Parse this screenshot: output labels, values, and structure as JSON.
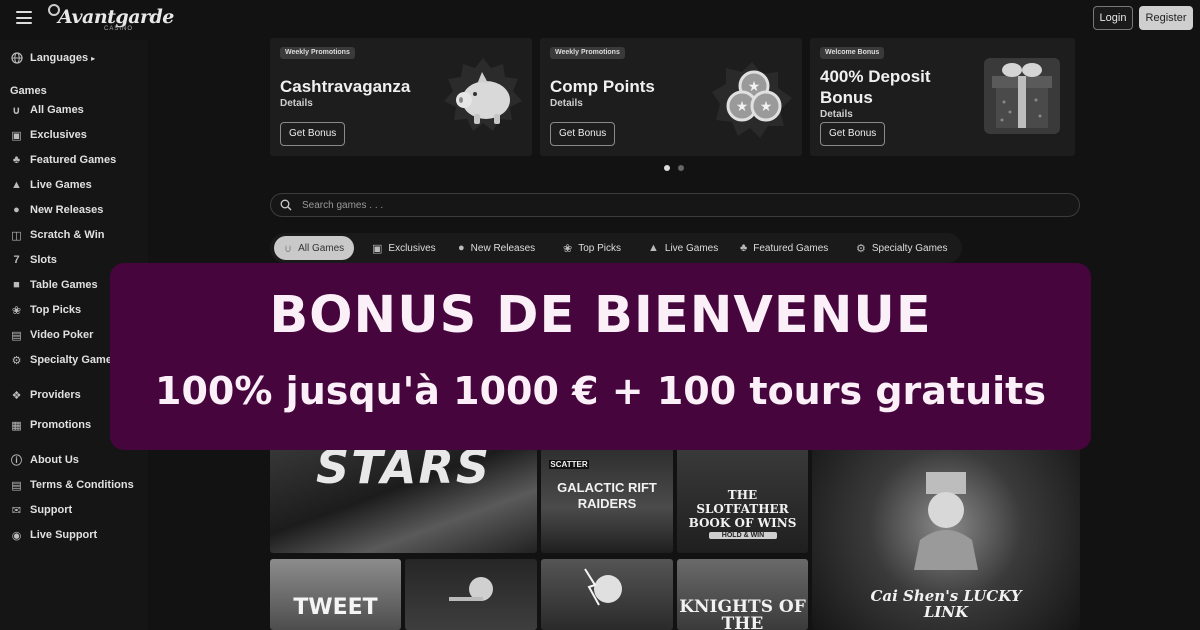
{
  "header": {
    "logo_text": "Avantgarde",
    "logo_sub": "CASINO",
    "login_label": "Login",
    "register_label": "Register"
  },
  "sidebar": {
    "languages_label": "Languages",
    "games_heading": "Games",
    "games_items": [
      {
        "label": "All Games",
        "icon": "horseshoe-icon"
      },
      {
        "label": "Exclusives",
        "icon": "exclusive-icon"
      },
      {
        "label": "Featured Games",
        "icon": "clover-icon"
      },
      {
        "label": "Live Games",
        "icon": "live-icon"
      },
      {
        "label": "New Releases",
        "icon": "new-icon"
      },
      {
        "label": "Scratch & Win",
        "icon": "scratch-icon"
      },
      {
        "label": "Slots",
        "icon": "seven-icon"
      },
      {
        "label": "Table Games",
        "icon": "table-icon"
      },
      {
        "label": "Top Picks",
        "icon": "award-icon"
      },
      {
        "label": "Video Poker",
        "icon": "poker-icon"
      },
      {
        "label": "Specialty Games",
        "icon": "gear-icon"
      }
    ],
    "providers_label": "Providers",
    "promotions_label": "Promotions",
    "footer_items": [
      {
        "label": "About Us",
        "icon": "info-icon"
      },
      {
        "label": "Terms & Conditions",
        "icon": "document-icon"
      },
      {
        "label": "Support",
        "icon": "mail-icon"
      },
      {
        "label": "Live Support",
        "icon": "chat-icon"
      }
    ]
  },
  "promos": [
    {
      "tag": "Weekly Promotions",
      "title": "Cashtravaganza",
      "details": "Details",
      "button": "Get Bonus",
      "art": "piggy-bank"
    },
    {
      "tag": "Weekly Promotions",
      "title": "Comp Points",
      "details": "Details",
      "button": "Get Bonus",
      "art": "star-coins"
    },
    {
      "tag": "Welcome Bonus",
      "title": "400% Deposit Bonus",
      "details": "Details",
      "button": "Get Bonus",
      "art": "gift-box"
    }
  ],
  "carousel": {
    "total": 2,
    "active": 1
  },
  "search": {
    "placeholder": "Search games . . ."
  },
  "tabs": [
    {
      "label": "All Games",
      "icon": "horseshoe-icon",
      "active": true
    },
    {
      "label": "Exclusives",
      "icon": "exclusive-icon"
    },
    {
      "label": "New Releases",
      "icon": "new-icon"
    },
    {
      "label": "Top Picks",
      "icon": "award-icon"
    },
    {
      "label": "Live Games",
      "icon": "live-icon"
    },
    {
      "label": "Featured Games",
      "icon": "clover-icon"
    },
    {
      "label": "Specialty Games",
      "icon": "gear-icon"
    }
  ],
  "games": [
    {
      "title": "STARS"
    },
    {
      "badge": "SCATTER",
      "title": "GALACTIC RIFT RAIDERS"
    },
    {
      "title": "THE SLOTFATHER BOOK OF WINS",
      "sub": "HOLD & WIN"
    },
    {
      "title": "Cai Shen's LUCKY LINK"
    },
    {
      "title": "TWEET"
    },
    {
      "title": ""
    },
    {
      "title": ""
    },
    {
      "title": "KNIGHTS OF THE"
    }
  ],
  "banner": {
    "title": "BONUS DE BIENVENUE",
    "subtitle": "100% jusqu'à 1000 € + 100 tours gratuits",
    "background": "#46063d"
  }
}
